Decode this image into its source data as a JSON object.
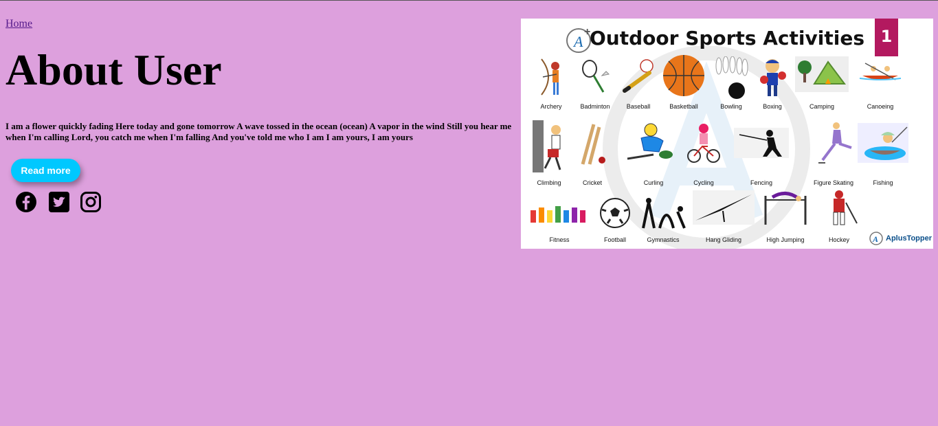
{
  "nav": {
    "home_label": "Home"
  },
  "page": {
    "title": "About User",
    "about_text": "I am a flower quickly fading Here today and gone tomorrow A wave tossed in the ocean (ocean) A vapor in the wind Still you hear me when I'm calling Lord, you catch me when I'm falling And you've told me who I am I am yours, I am yours",
    "read_more_label": "Read more"
  },
  "social": {
    "icons": [
      "facebook-icon",
      "twitter-icon",
      "instagram-icon"
    ]
  },
  "poster": {
    "title": "Outdoor Sports Activities",
    "badge": "1",
    "brand": "AplusTopper",
    "row1": [
      "Archery",
      "Badminton",
      "Baseball",
      "Basketball",
      "Bowling",
      "Boxing",
      "Camping",
      "Canoeing"
    ],
    "row2": [
      "Climbing",
      "Cricket",
      "Curling",
      "Cycling",
      "Fencing",
      "Figure Skating",
      "Fishing"
    ],
    "row3": [
      "Fitness",
      "Football",
      "Gymnastics",
      "Hang Gliding",
      "High Jumping",
      "Hockey"
    ]
  },
  "colors": {
    "background": "#dda0dd",
    "button": "#00c8ff",
    "badge": "#b3195f"
  }
}
